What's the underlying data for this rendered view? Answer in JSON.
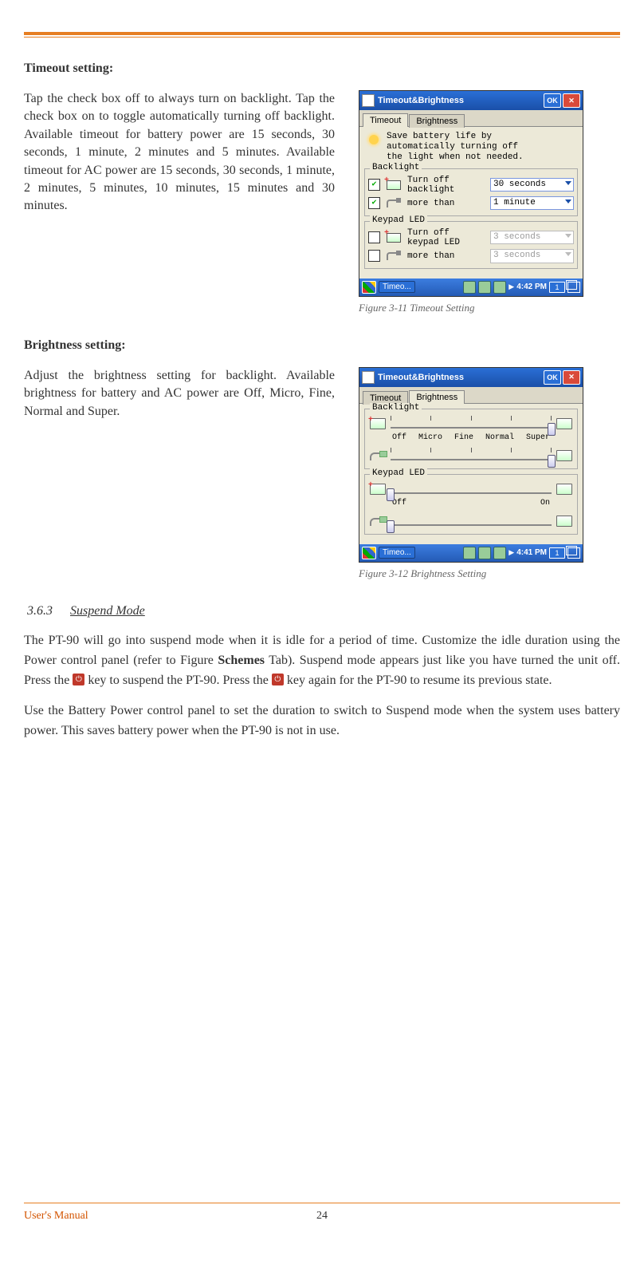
{
  "sections": {
    "timeout_heading": "Timeout setting:",
    "timeout_para": "Tap the check box off to always turn on backlight. Tap the check box on to toggle automatically turning off backlight. Available timeout for battery power are 15 seconds, 30 seconds, 1 minute, 2 minutes and 5 minutes. Available timeout for AC power are 15 seconds, 30 seconds, 1 minute, 2 minutes, 5 minutes, 10 minutes, 15 minutes and 30 minutes.",
    "brightness_heading": "Brightness setting:",
    "brightness_para": "Adjust the brightness setting for backlight. Available brightness for battery and AC power are Off, Micro, Fine, Normal and Super.",
    "suspend_num": "3.6.3",
    "suspend_title": "Suspend Mode",
    "suspend_p1a": "The PT-90 will go into suspend mode when it is idle for a period of time. Customize the idle duration using the Power control panel (refer to Figure ",
    "suspend_p1b": "Schemes",
    "suspend_p1c": " Tab). Suspend mode appears just like you have turned the unit off. Press the ",
    "suspend_p1d": " key to suspend the PT-90. Press the ",
    "suspend_p1e": " key again for the PT-90 to resume its previous state.",
    "suspend_p2": "Use the Battery Power control panel to set the duration to switch to Suspend mode when the system uses battery power. This saves battery power when the PT-90 is not in use."
  },
  "fig1": {
    "title": "Timeout&Brightness",
    "ok": "OK",
    "tab_timeout": "Timeout",
    "tab_brightness": "Brightness",
    "hint1": "Save battery life by",
    "hint2": "automatically turning off",
    "hint3": "the light when not needed.",
    "grp_backlight": "Backlight",
    "lbl_turnoff_backlight": "Turn off backlight more than",
    "lbl_line1": "Turn off",
    "lbl_line2": "backlight",
    "lbl_line3": "more than",
    "dd_backlight_bat": "30 seconds",
    "dd_backlight_ac": "1 minute",
    "grp_keypad": "Keypad LED",
    "lbl_k1": "Turn off",
    "lbl_k2": "keypad LED",
    "lbl_k3": "more than",
    "dd_keypad_bat": "3 seconds",
    "dd_keypad_ac": "3 seconds",
    "task_label": "Timeo...",
    "time": "4:42 PM",
    "tray_num": "1",
    "caption": "Figure 3-11 Timeout Setting"
  },
  "fig2": {
    "title": "Timeout&Brightness",
    "ok": "OK",
    "tab_timeout": "Timeout",
    "tab_brightness": "Brightness",
    "grp_backlight": "Backlight",
    "labels": [
      "Off",
      "Micro",
      "Fine",
      "Normal",
      "Super"
    ],
    "grp_keypad": "Keypad LED",
    "keypad_labels": [
      "Off",
      "On"
    ],
    "task_label": "Timeo...",
    "time": "4:41 PM",
    "tray_num": "1",
    "caption": "Figure 3-12 Brightness Setting"
  },
  "footer": {
    "label": "User's Manual",
    "page": "24"
  },
  "power_glyph": "⏻"
}
